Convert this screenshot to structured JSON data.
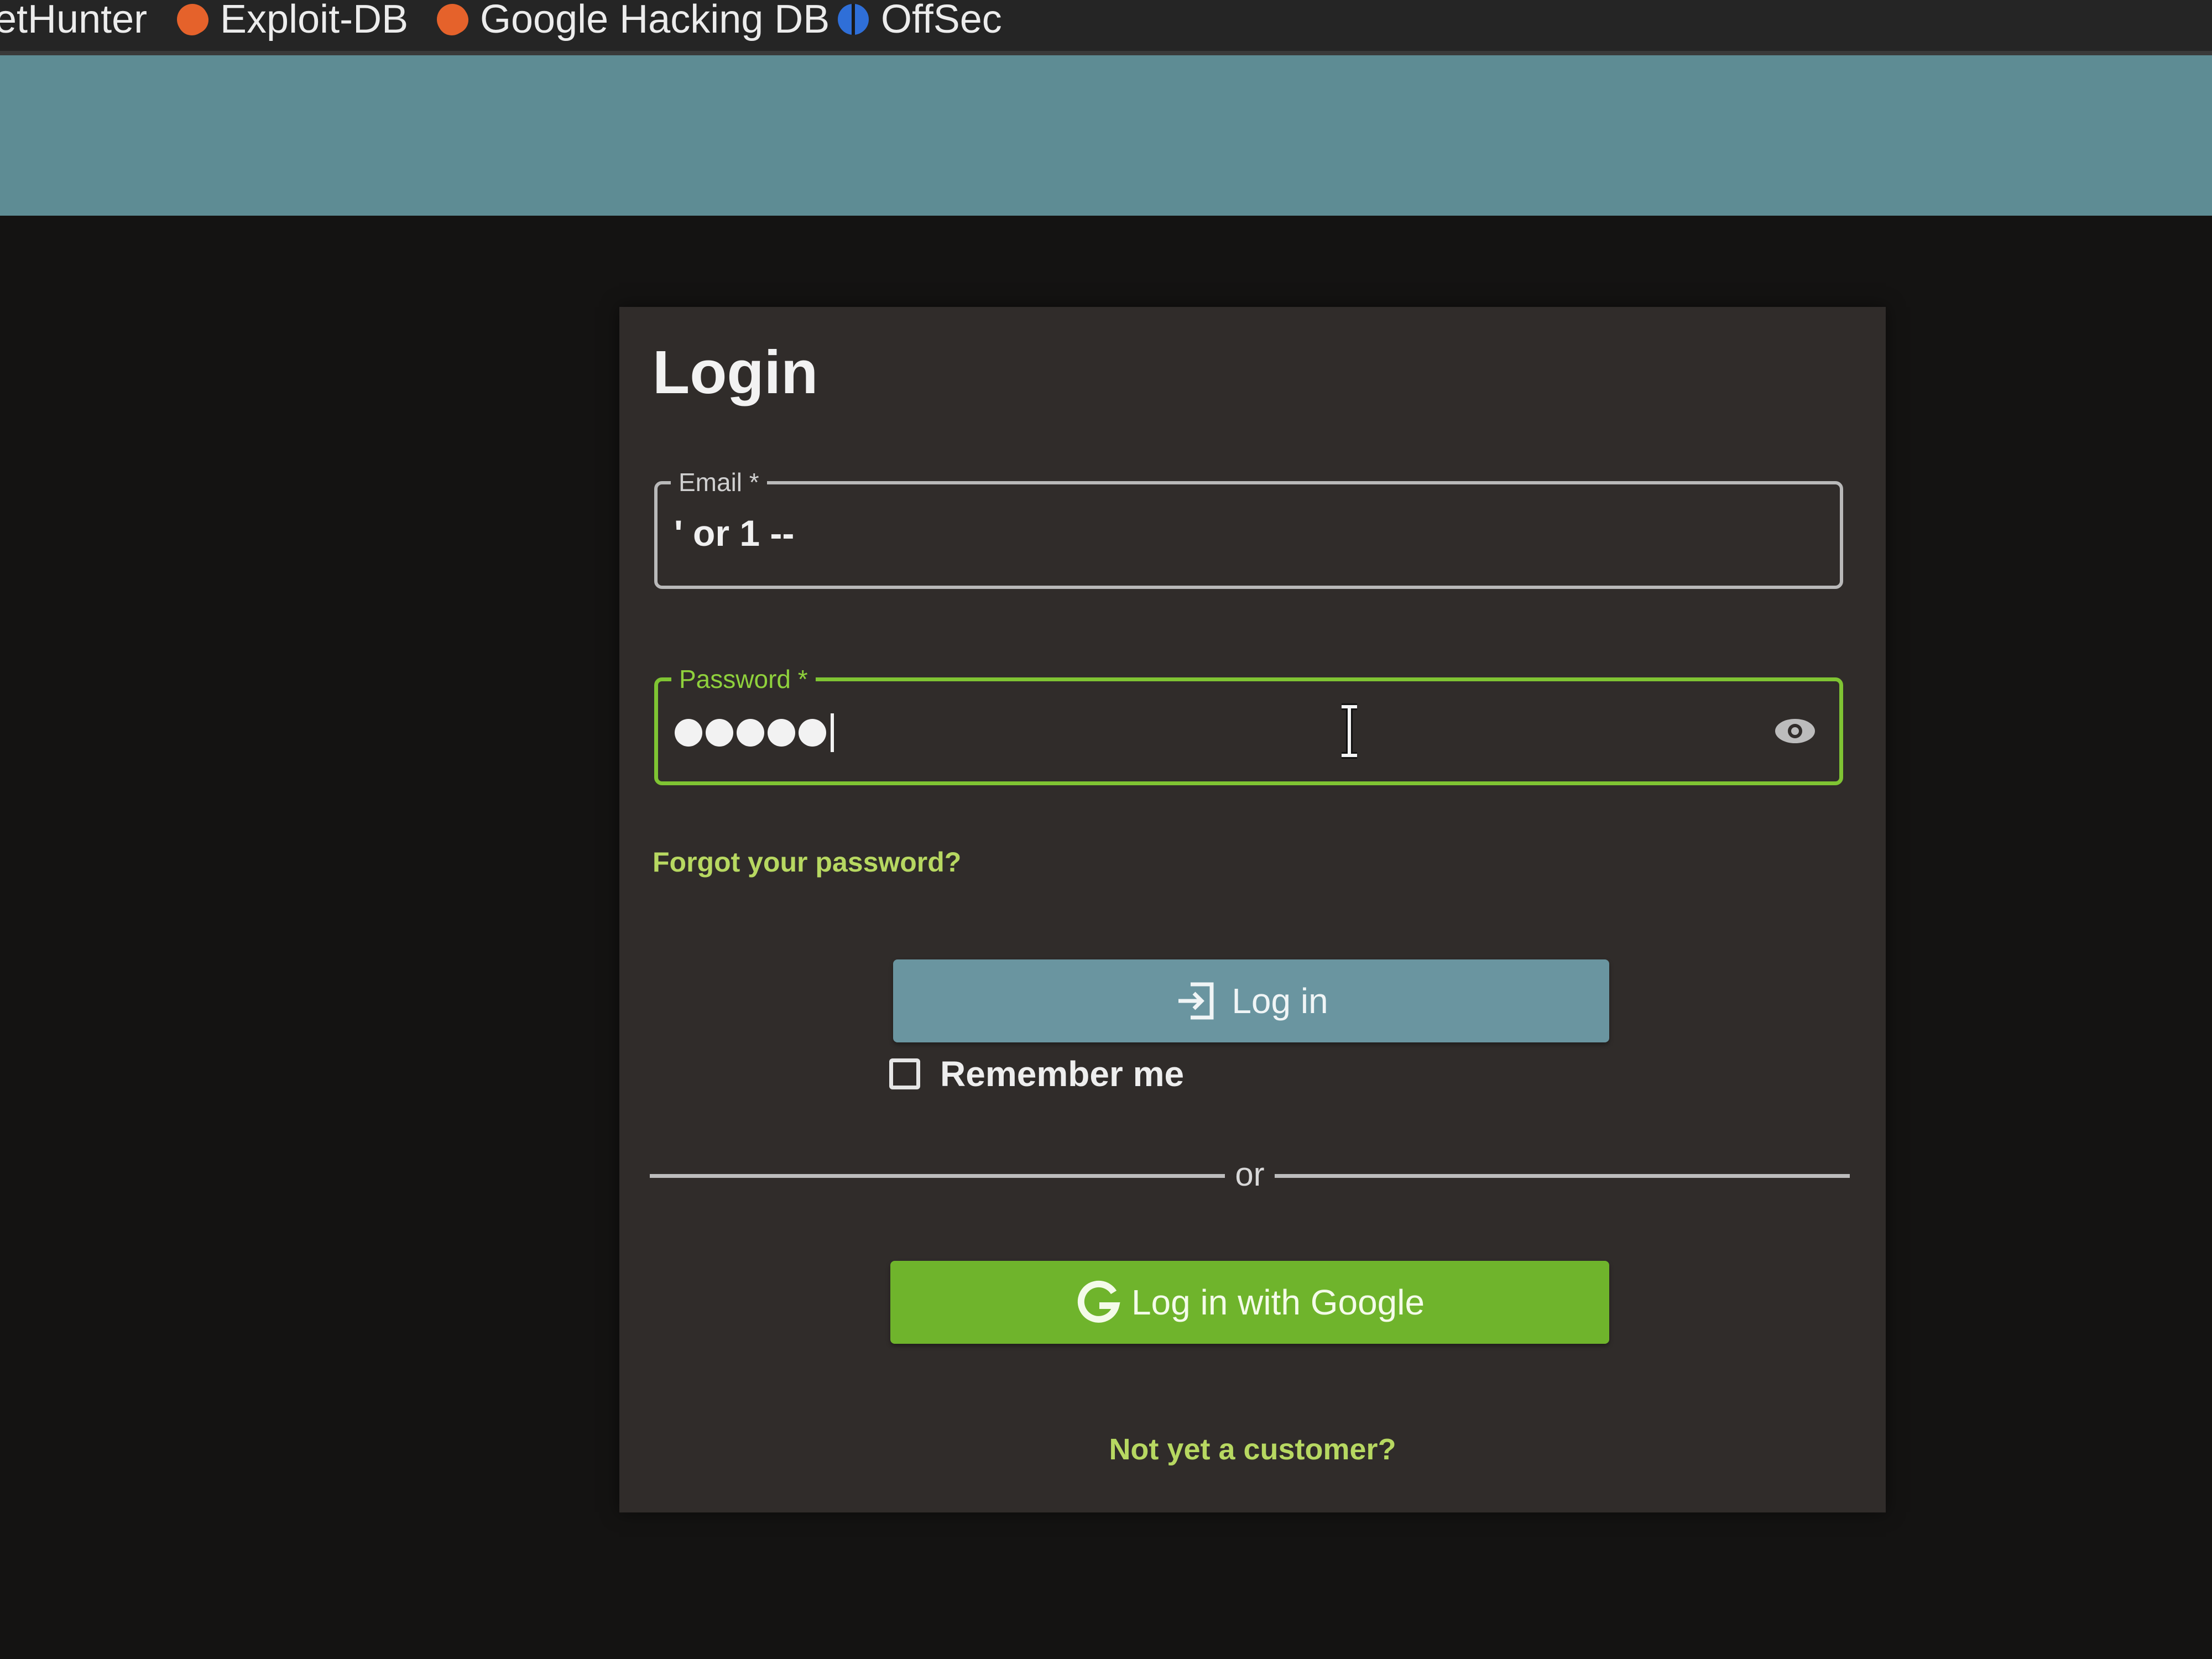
{
  "bookmarks": [
    {
      "label": "etHunter",
      "icon": "none"
    },
    {
      "label": "Exploit-DB",
      "icon": "bug-icon"
    },
    {
      "label": "Google Hacking DB",
      "icon": "bug-icon"
    },
    {
      "label": "OffSec",
      "icon": "offsec-icon"
    }
  ],
  "login": {
    "title": "Login",
    "email": {
      "label": "Email *",
      "value": "' or 1 --"
    },
    "password": {
      "label": "Password *",
      "masked_length": 5
    },
    "forgot_link": "Forgot your password?",
    "login_button": "Log in",
    "remember_label": "Remember me",
    "remember_checked": false,
    "divider_text": "or",
    "google_button": "Log in with Google",
    "signup_link": "Not yet a customer?"
  },
  "colors": {
    "header_band": "#5e8c94",
    "card_background": "#302c2a",
    "accent_green": "#7fc433",
    "link_color": "#b7d861",
    "login_button": "#6a95a0",
    "google_button": "#6fb42c"
  }
}
